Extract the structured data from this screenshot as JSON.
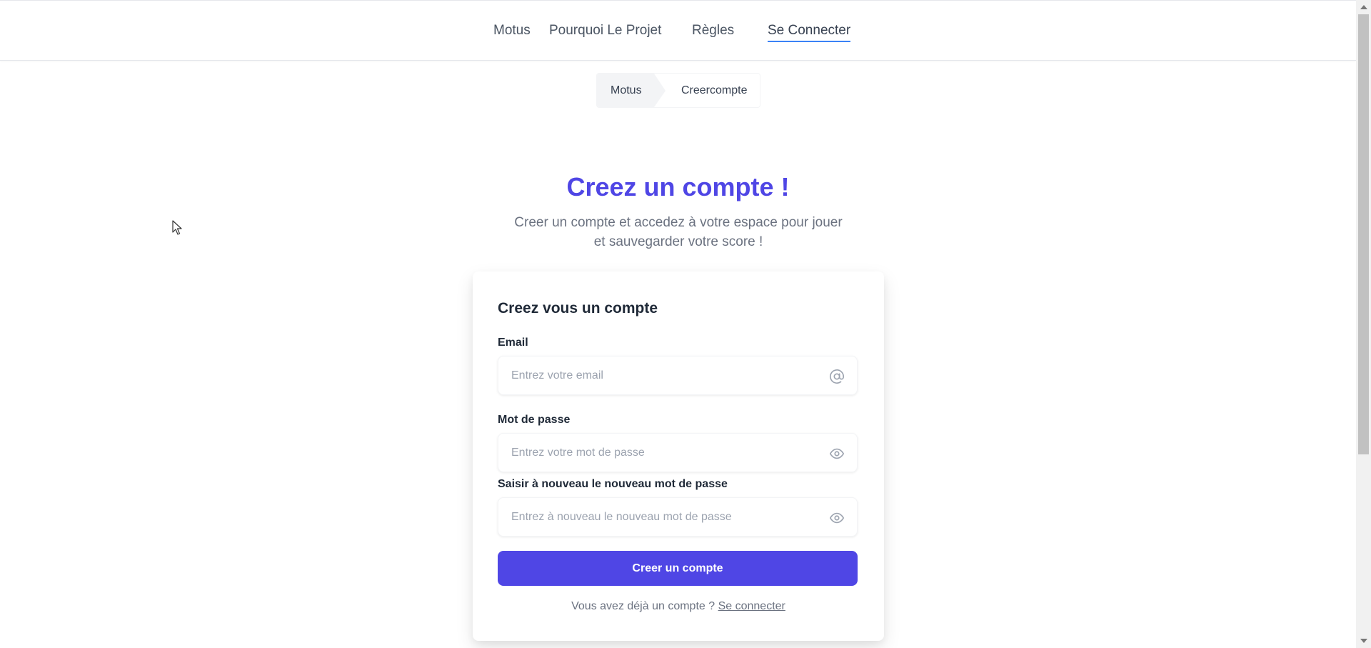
{
  "nav": {
    "items": [
      {
        "label": "Motus"
      },
      {
        "label": "Pourquoi Le Projet"
      },
      {
        "label": "Règles"
      },
      {
        "label": "Se Connecter"
      }
    ]
  },
  "breadcrumb": {
    "first": "Motus",
    "second": "Creercompte"
  },
  "hero": {
    "title": "Creez un compte !",
    "subtitle": "Creer un compte et accedez à votre espace pour jouer et sauvegarder votre score !"
  },
  "form": {
    "title": "Creez vous un compte",
    "email": {
      "label": "Email",
      "placeholder": "Entrez votre email",
      "value": "",
      "icon": "at-icon"
    },
    "password": {
      "label": "Mot de passe",
      "placeholder": "Entrez votre mot de passe",
      "value": "",
      "icon": "eye-icon"
    },
    "confirm": {
      "label": "Saisir à nouveau le nouveau mot de passe",
      "placeholder": "Entrez à nouveau le nouveau mot de passe",
      "value": "",
      "icon": "eye-icon"
    },
    "submit_label": "Creer un compte",
    "signin_prompt": "Vous avez déjà un compte ?",
    "signin_link": "Se connecter"
  },
  "colors": {
    "accent": "#4f46e5",
    "active_underline": "#3b82f6",
    "muted_text": "#6b7280"
  }
}
